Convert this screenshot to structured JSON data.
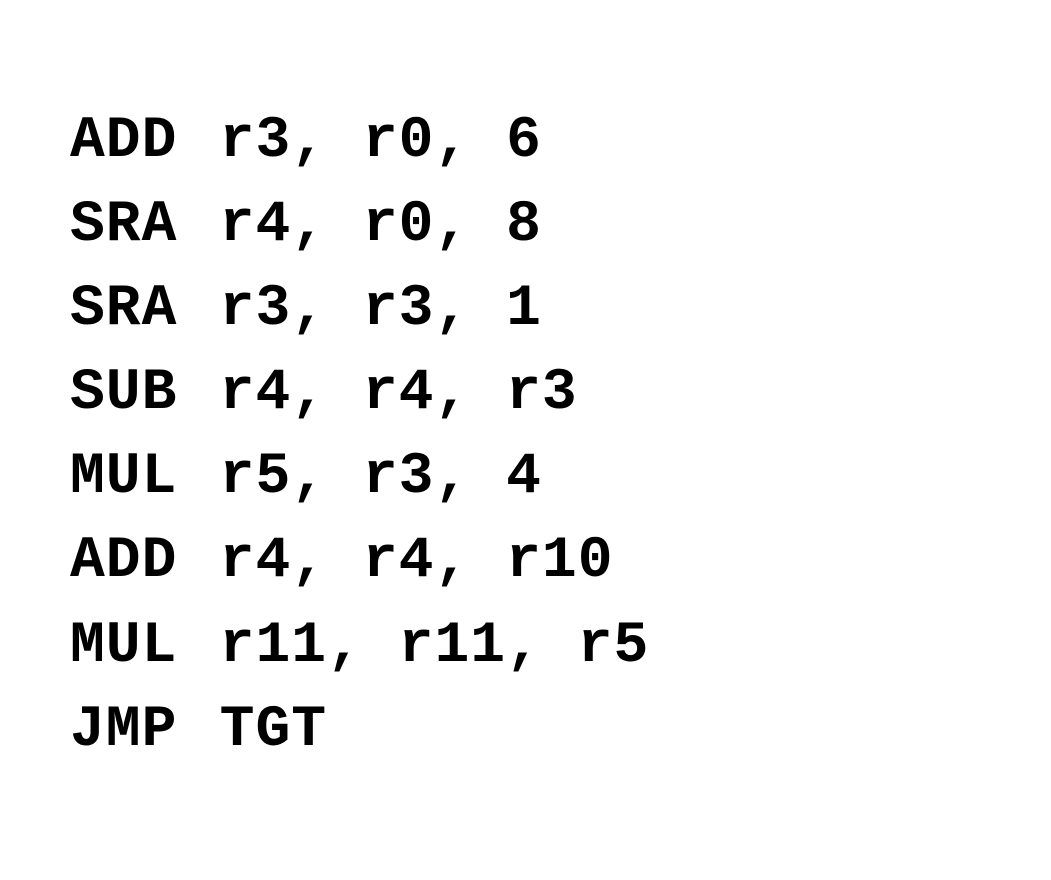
{
  "lines": [
    {
      "mnemonic": "ADD",
      "operands": "r3, r0, 6"
    },
    {
      "mnemonic": "SRA",
      "operands": "r4, r0, 8"
    },
    {
      "mnemonic": "SRA",
      "operands": "r3, r3, 1"
    },
    {
      "mnemonic": "SUB",
      "operands": "r4, r4, r3"
    },
    {
      "mnemonic": "MUL",
      "operands": "r5, r3, 4"
    },
    {
      "mnemonic": "ADD",
      "operands": "r4, r4, r10"
    },
    {
      "mnemonic": "MUL",
      "operands": "r11, r11, r5"
    },
    {
      "mnemonic": "JMP",
      "operands": "TGT"
    }
  ]
}
